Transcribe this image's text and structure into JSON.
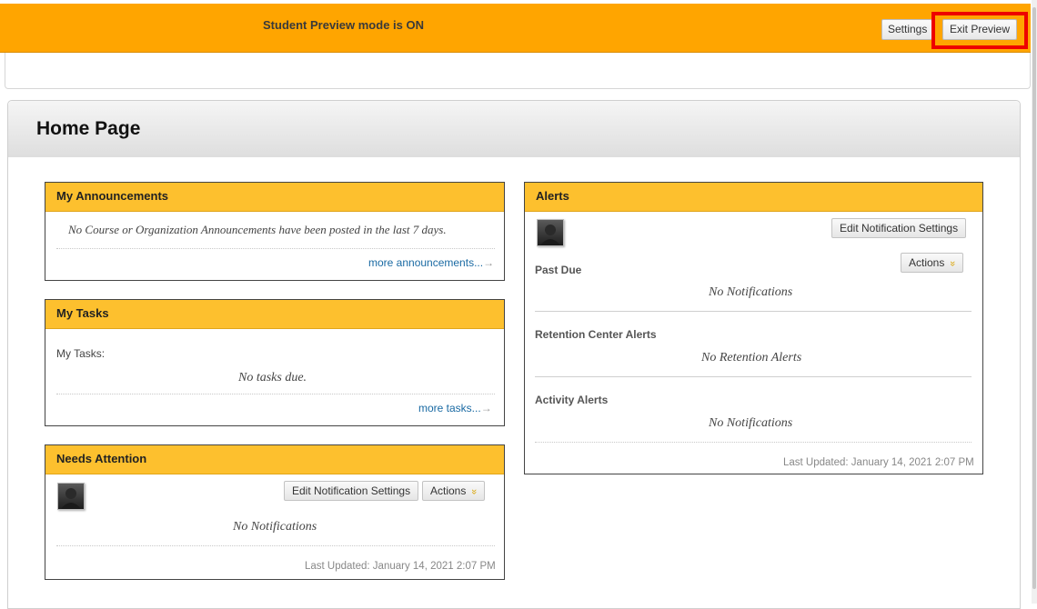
{
  "preview_bar": {
    "message": "Student Preview mode is ON",
    "settings_label": "Settings",
    "exit_label": "Exit Preview"
  },
  "page": {
    "title": "Home Page"
  },
  "announcements": {
    "title": "My Announcements",
    "empty_text": "No Course or Organization Announcements have been posted in the last 7 days.",
    "more_label": "more announcements...",
    "arrow": "→"
  },
  "tasks": {
    "title": "My Tasks",
    "label": "My Tasks:",
    "empty_text": "No tasks due.",
    "more_label": "more tasks...",
    "arrow": "→"
  },
  "needs_attention": {
    "title": "Needs Attention",
    "edit_label": "Edit Notification Settings",
    "actions_label": "Actions",
    "chevron": "»",
    "empty_text": "No Notifications",
    "last_updated": "Last Updated: January 14, 2021 2:07 PM"
  },
  "alerts": {
    "title": "Alerts",
    "edit_label": "Edit Notification Settings",
    "actions_label": "Actions",
    "chevron": "»",
    "sections": [
      {
        "title": "Past Due",
        "empty_text": "No Notifications"
      },
      {
        "title": "Retention Center Alerts",
        "empty_text": "No Retention Alerts"
      },
      {
        "title": "Activity Alerts",
        "empty_text": "No Notifications"
      }
    ],
    "last_updated": "Last Updated: January 14, 2021 2:07 PM"
  },
  "colors": {
    "preview_bar": "#ffa500",
    "module_header": "#fdc02e",
    "highlight": "#ee0000",
    "link": "#1a6aa3"
  },
  "icons": [
    "avatar-icon",
    "arrow-right-icon",
    "double-chevron-down-icon"
  ]
}
